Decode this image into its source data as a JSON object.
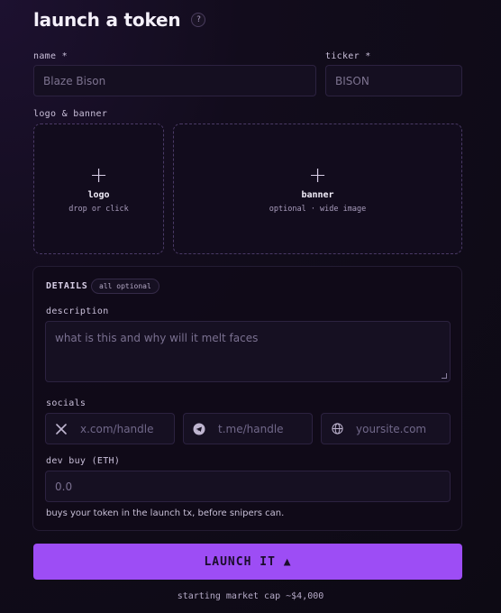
{
  "page": {
    "title": "launch a token",
    "help_label": "?"
  },
  "name": {
    "label": "name *",
    "placeholder": "Blaze Bison"
  },
  "ticker": {
    "label": "ticker *",
    "placeholder": "BISON"
  },
  "media": {
    "label": "logo & banner",
    "logo": {
      "plus": "+",
      "title": "logo",
      "subtitle": "drop or click"
    },
    "banner": {
      "plus": "+",
      "title": "banner",
      "subtitle": "optional · wide image"
    }
  },
  "details": {
    "heading": "DETAILS",
    "badge": "all optional",
    "description": {
      "label": "description",
      "placeholder": "what is this and why will it melt faces"
    },
    "socials": {
      "label": "socials",
      "items": [
        {
          "icon": "x-icon",
          "placeholder": "x.com/handle"
        },
        {
          "icon": "telegram-icon",
          "placeholder": "t.me/handle"
        },
        {
          "icon": "globe-icon",
          "placeholder": "yoursite.com"
        }
      ]
    },
    "dev_buy": {
      "label": "dev buy (ETH)",
      "placeholder": "0.0",
      "hint": "buys your token in the launch tx, before snipers can."
    }
  },
  "launch": {
    "label": "LAUNCH IT ▲"
  },
  "footer": {
    "market_cap": "starting market cap ~$4,000"
  },
  "colors": {
    "accent": "#9d4df5",
    "background": "#0d0a14",
    "input_bg": "#150f21"
  }
}
